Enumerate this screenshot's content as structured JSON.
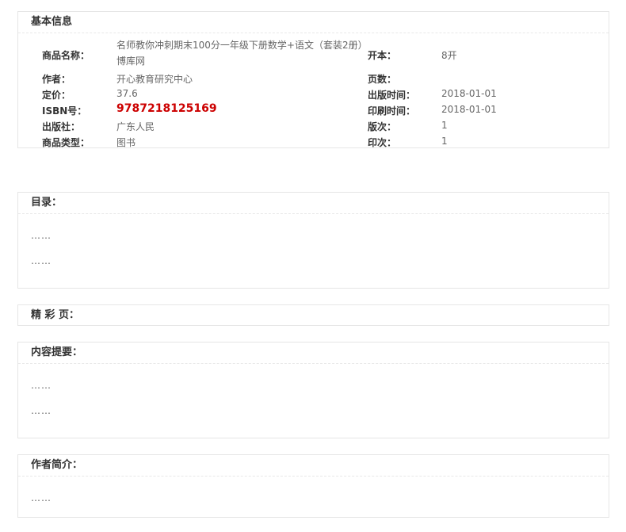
{
  "basic_info": {
    "title": "基本信息",
    "left": [
      {
        "label": "商品名称：",
        "value": "名师教你冲刺期末100分一年级下册数学+语文（套装2册）博库网"
      },
      {
        "label": "作者：",
        "value": "开心教育研究中心"
      },
      {
        "label": "定价：",
        "value": "37.6"
      },
      {
        "label": "ISBN号：",
        "value": "9787218125169"
      },
      {
        "label": "出版社：",
        "value": "广东人民"
      },
      {
        "label": "商品类型：",
        "value": "图书"
      }
    ],
    "right": [
      {
        "label": "开本：",
        "value": "8开"
      },
      {
        "label": "页数：",
        "value": ""
      },
      {
        "label": "出版时间：",
        "value": "2018-01-01"
      },
      {
        "label": "印刷时间：",
        "value": "2018-01-01"
      },
      {
        "label": "版次：",
        "value": "1"
      },
      {
        "label": "印次：",
        "value": "1"
      }
    ]
  },
  "toc": {
    "title": "目录：",
    "lines": [
      "……",
      "……"
    ]
  },
  "highlights": {
    "title": "精 彩 页："
  },
  "summary": {
    "title": "内容提要：",
    "lines": [
      "……",
      "……"
    ]
  },
  "author_intro": {
    "title": "作者简介：",
    "lines": [
      "……"
    ]
  }
}
